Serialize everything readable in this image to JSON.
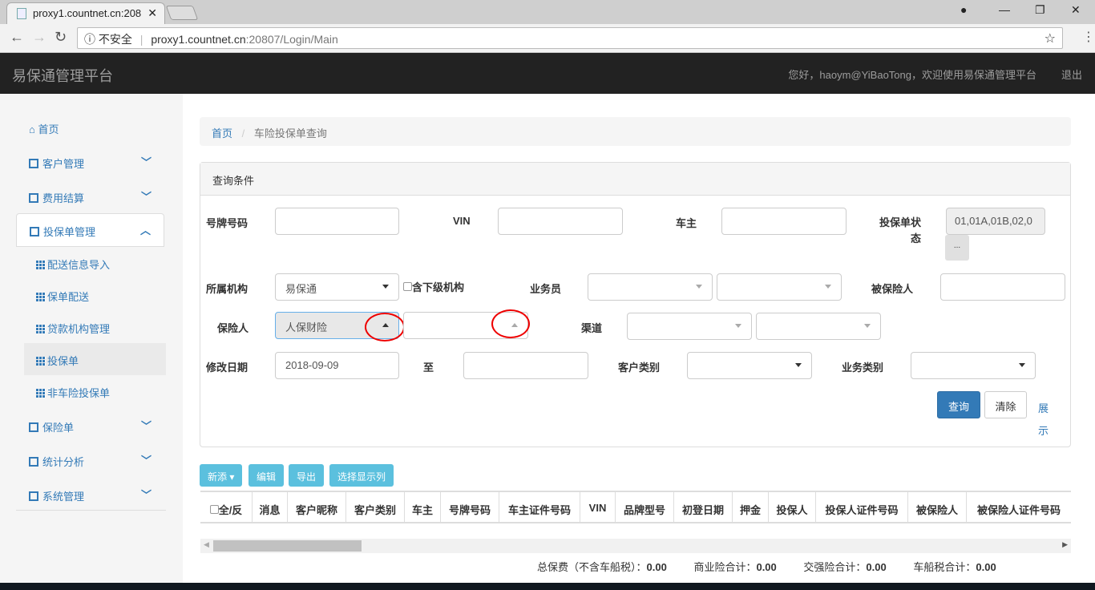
{
  "browser": {
    "tab_title": "proxy1.countnet.cn:208",
    "security": "不安全",
    "url_host": "proxy1.countnet.cn",
    "url_rest": ":20807/Login/Main"
  },
  "app": {
    "brand": "易保通管理平台",
    "greeting": "您好，haoym@YiBaoTong，欢迎使用易保通管理平台",
    "logout": "退出"
  },
  "sidebar": {
    "items": [
      {
        "label": "首页"
      },
      {
        "label": "客户管理"
      },
      {
        "label": "费用结算"
      },
      {
        "label": "投保单管理"
      },
      {
        "label": "配送信息导入"
      },
      {
        "label": "保单配送"
      },
      {
        "label": "贷款机构管理"
      },
      {
        "label": "投保单"
      },
      {
        "label": "非车险投保单"
      },
      {
        "label": "保险单"
      },
      {
        "label": "统计分析"
      },
      {
        "label": "系统管理"
      }
    ]
  },
  "breadcrumb": {
    "home": "首页",
    "current": "车险投保单查询"
  },
  "query": {
    "title": "查询条件",
    "plate_label": "号牌号码",
    "vin_label": "VIN",
    "owner_label": "车主",
    "status_label": "投保单状态",
    "status_value": "01,01A,01B,02,0",
    "status_more": "...",
    "org_label": "所属机构",
    "org_value": "易保通",
    "sub_org_label": "含下级机构",
    "salesman_label": "业务员",
    "insured_label": "被保险人",
    "insurer_label": "保险人",
    "insurer_value": "人保财险",
    "channel_label": "渠道",
    "date_label": "修改日期",
    "date_from": "2018-09-09",
    "date_to_label": "至",
    "cust_type_label": "客户类别",
    "biz_type_label": "业务类别",
    "search": "查询",
    "clear": "清除",
    "expand": "展示"
  },
  "toolbar": {
    "add": "新添",
    "edit": "编辑",
    "export": "导出",
    "columns": "选择显示列"
  },
  "table": {
    "columns": [
      "全/反",
      "消息",
      "客户昵称",
      "客户类别",
      "车主",
      "号牌号码",
      "车主证件号码",
      "VIN",
      "品牌型号",
      "初登日期",
      "押金",
      "投保人",
      "投保人证件号码",
      "被保险人",
      "被保险人证件号码"
    ]
  },
  "totals": {
    "total_label": "总保费（不含车船税）：",
    "total": "0.00",
    "commercial_label": "商业险合计：",
    "commercial": "0.00",
    "compulsory_label": "交强险合计：",
    "compulsory": "0.00",
    "tax_label": "车船税合计：",
    "tax": "0.00"
  }
}
